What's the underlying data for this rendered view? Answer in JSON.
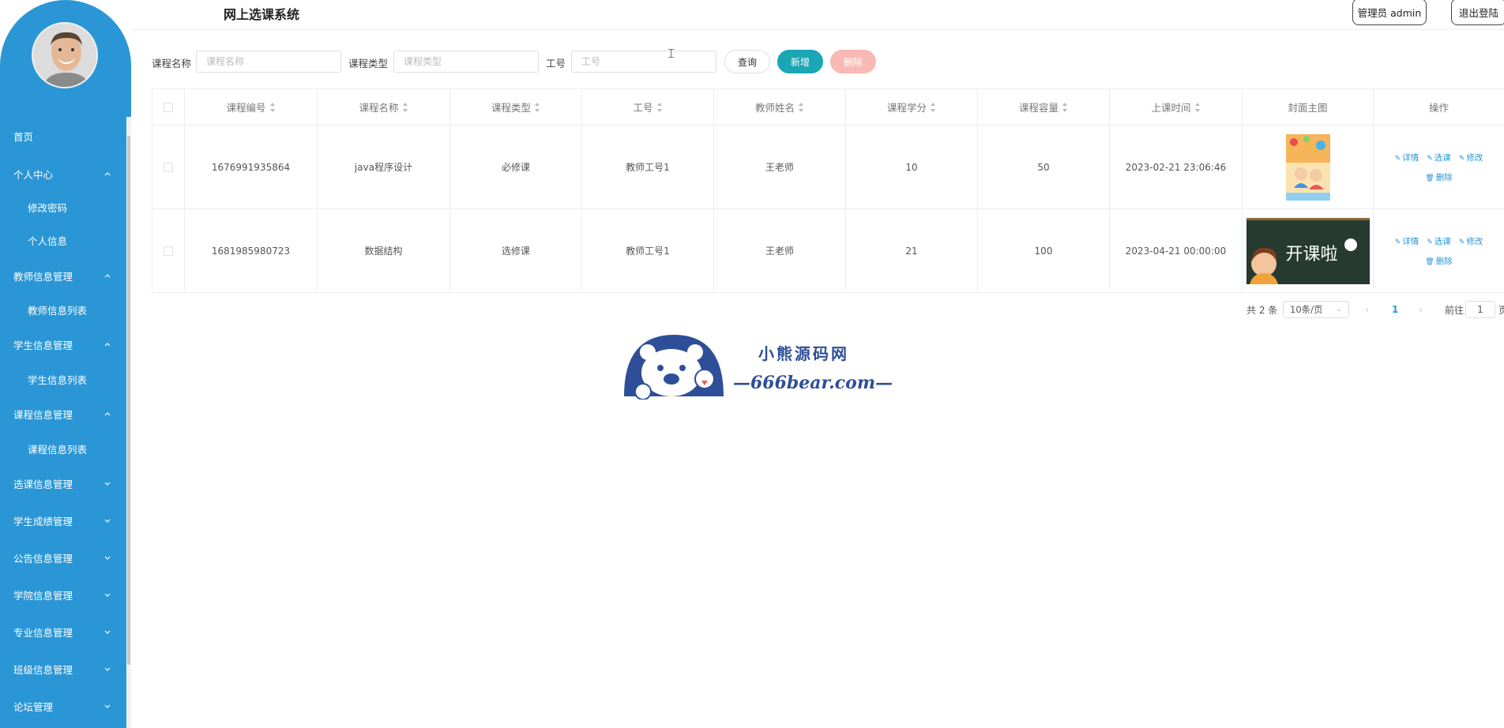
{
  "header": {
    "title": "网上选课系统",
    "admin_label": "管理员 admin",
    "logout_label": "退出登陆"
  },
  "sidebar": {
    "items": [
      {
        "label": "首页"
      },
      {
        "label": "个人中心"
      },
      {
        "label": "修改密码"
      },
      {
        "label": "个人信息"
      },
      {
        "label": "教师信息管理"
      },
      {
        "label": "教师信息列表"
      },
      {
        "label": "学生信息管理"
      },
      {
        "label": "学生信息列表"
      },
      {
        "label": "课程信息管理"
      },
      {
        "label": "课程信息列表"
      },
      {
        "label": "选课信息管理"
      },
      {
        "label": "学生成绩管理"
      },
      {
        "label": "公告信息管理"
      },
      {
        "label": "学院信息管理"
      },
      {
        "label": "专业信息管理"
      },
      {
        "label": "班级信息管理"
      },
      {
        "label": "论坛管理"
      }
    ]
  },
  "search": {
    "course_name_label": "课程名称",
    "course_name_placeholder": "课程名称",
    "course_type_label": "课程类型",
    "course_type_placeholder": "课程类型",
    "job_no_label": "工号",
    "job_no_placeholder": "工号",
    "query_label": "查询",
    "add_label": "新增",
    "delete_label": "删除"
  },
  "table": {
    "columns": [
      "课程编号",
      "课程名称",
      "课程类型",
      "工号",
      "教师姓名",
      "课程学分",
      "课程容量",
      "上课时间",
      "封面主图",
      "操作"
    ],
    "rows": [
      {
        "id": "1676991935864",
        "name": "java程序设计",
        "type": "必修课",
        "job_no": "教师工号1",
        "teacher": "王老师",
        "credit": "10",
        "capacity": "50",
        "time": "2023-02-21 23:06:46"
      },
      {
        "id": "1681985980723",
        "name": "数据结构",
        "type": "选修课",
        "job_no": "教师工号1",
        "teacher": "王老师",
        "credit": "21",
        "capacity": "100",
        "time": "2023-04-21 00:00:00"
      }
    ],
    "actions": {
      "detail": "详情",
      "select": "选课",
      "edit": "修改",
      "delete": "删除"
    },
    "cover2_text": "开课啦"
  },
  "pager": {
    "total": "共 2 条",
    "size": "10条/页",
    "current": "1",
    "goto_label": "前往",
    "goto_value": "1",
    "page_suffix": "页"
  },
  "watermark": {
    "line1": "小熊源码网",
    "line2": "—666bear.com—"
  }
}
